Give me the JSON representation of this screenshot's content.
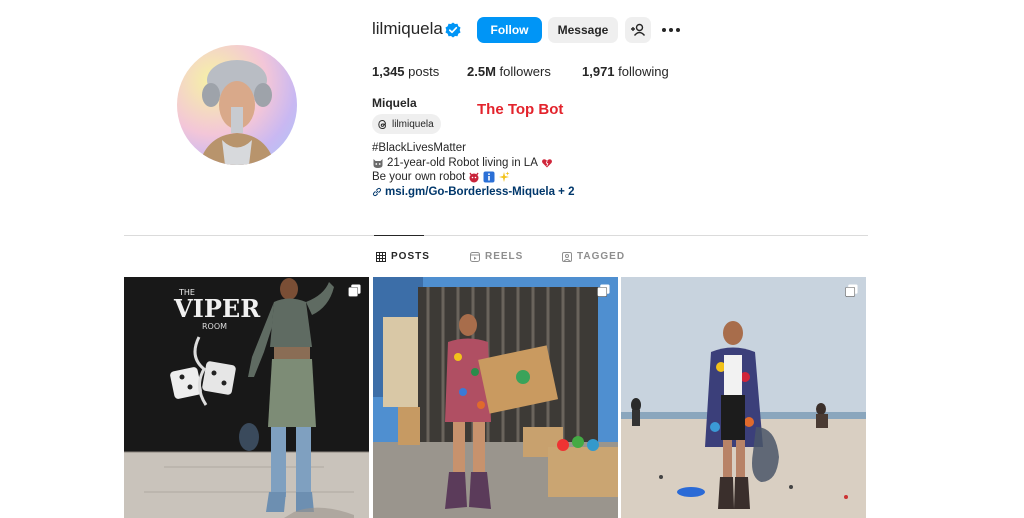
{
  "profile": {
    "username": "lilmiquela",
    "full_name": "Miquela",
    "threads_handle": "lilmiquela",
    "annotation": "The Top Bot"
  },
  "actions": {
    "follow": "Follow",
    "message": "Message"
  },
  "stats": {
    "posts_count": "1,345",
    "posts_label": "posts",
    "followers_count": "2.5M",
    "followers_label": "followers",
    "following_count": "1,971",
    "following_label": "following"
  },
  "bio": {
    "line1": "#BlackLivesMatter",
    "line2": "21-year-old Robot living in LA",
    "line3": "Be your own robot",
    "link": "msi.gm/Go-Borderless-Miquela + 2"
  },
  "tabs": [
    {
      "label": "POSTS",
      "icon": "grid-icon",
      "active": true
    },
    {
      "label": "REELS",
      "icon": "reels-icon",
      "active": false
    },
    {
      "label": "TAGGED",
      "icon": "tagged-icon",
      "active": false
    }
  ],
  "posts": [
    {
      "wall_text_1": "VIPER",
      "wall_text_2": "THE",
      "wall_text_3": "ROOM",
      "icon": "multi-image-icon"
    },
    {
      "icon": "multi-image-icon"
    },
    {
      "icon": "multi-image-icon"
    }
  ],
  "colors": {
    "follow_button": "#0095f6",
    "secondary_button": "#efefef",
    "verified": "#0095f6",
    "annotation": "#e3232c",
    "link": "#00376b"
  }
}
